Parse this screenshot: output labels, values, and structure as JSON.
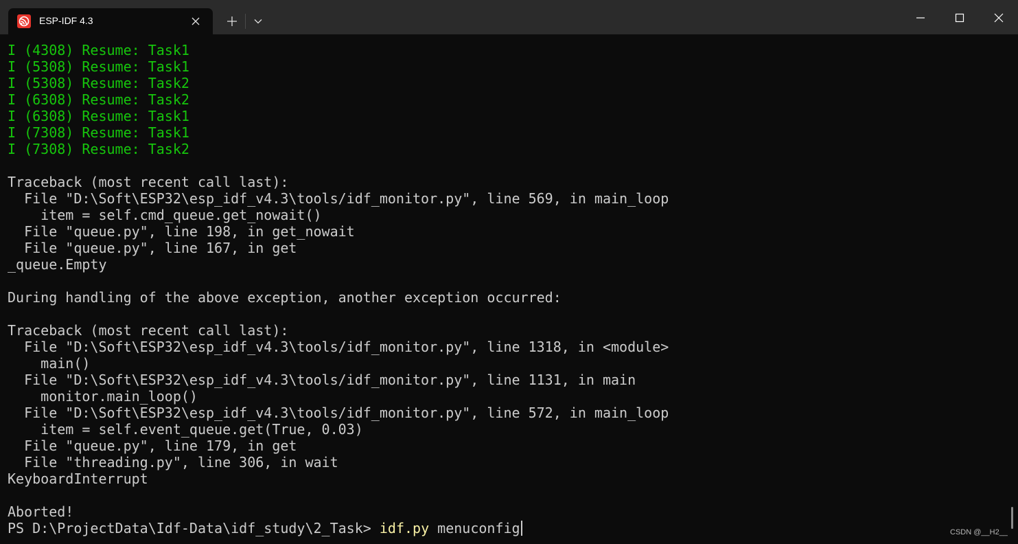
{
  "window": {
    "tab_title": "ESP-IDF 4.3",
    "tab_icon": "espressif-logo-icon",
    "colors": {
      "titlebar": "#2b2b2b",
      "terminal_bg": "#0c0c0c",
      "text": "#cccccc",
      "info_green": "#16c60c",
      "command_yellow": "#f9f1a5"
    }
  },
  "terminal": {
    "lines": [
      {
        "text": "I (4308) Resume: Task1",
        "style": "green"
      },
      {
        "text": "I (5308) Resume: Task1",
        "style": "green"
      },
      {
        "text": "I (5308) Resume: Task2",
        "style": "green"
      },
      {
        "text": "I (6308) Resume: Task2",
        "style": "green"
      },
      {
        "text": "I (6308) Resume: Task1",
        "style": "green"
      },
      {
        "text": "I (7308) Resume: Task1",
        "style": "green"
      },
      {
        "text": "I (7308) Resume: Task2",
        "style": "green"
      },
      {
        "text": "",
        "style": "normal"
      },
      {
        "text": "Traceback (most recent call last):",
        "style": "normal"
      },
      {
        "text": "  File \"D:\\Soft\\ESP32\\esp_idf_v4.3\\tools/idf_monitor.py\", line 569, in main_loop",
        "style": "normal"
      },
      {
        "text": "    item = self.cmd_queue.get_nowait()",
        "style": "normal"
      },
      {
        "text": "  File \"queue.py\", line 198, in get_nowait",
        "style": "normal"
      },
      {
        "text": "  File \"queue.py\", line 167, in get",
        "style": "normal"
      },
      {
        "text": "_queue.Empty",
        "style": "normal"
      },
      {
        "text": "",
        "style": "normal"
      },
      {
        "text": "During handling of the above exception, another exception occurred:",
        "style": "normal"
      },
      {
        "text": "",
        "style": "normal"
      },
      {
        "text": "Traceback (most recent call last):",
        "style": "normal"
      },
      {
        "text": "  File \"D:\\Soft\\ESP32\\esp_idf_v4.3\\tools/idf_monitor.py\", line 1318, in <module>",
        "style": "normal"
      },
      {
        "text": "    main()",
        "style": "normal"
      },
      {
        "text": "  File \"D:\\Soft\\ESP32\\esp_idf_v4.3\\tools/idf_monitor.py\", line 1131, in main",
        "style": "normal"
      },
      {
        "text": "    monitor.main_loop()",
        "style": "normal"
      },
      {
        "text": "  File \"D:\\Soft\\ESP32\\esp_idf_v4.3\\tools/idf_monitor.py\", line 572, in main_loop",
        "style": "normal"
      },
      {
        "text": "    item = self.event_queue.get(True, 0.03)",
        "style": "normal"
      },
      {
        "text": "  File \"queue.py\", line 179, in get",
        "style": "normal"
      },
      {
        "text": "  File \"threading.py\", line 306, in wait",
        "style": "normal"
      },
      {
        "text": "KeyboardInterrupt",
        "style": "normal"
      },
      {
        "text": "",
        "style": "normal"
      },
      {
        "text": "Aborted!",
        "style": "normal"
      }
    ],
    "prompt": {
      "path": "PS D:\\ProjectData\\Idf-Data\\idf_study\\2_Task> ",
      "command": "idf.py",
      "args": " menuconfig"
    }
  },
  "watermark": "CSDN @__H2__"
}
